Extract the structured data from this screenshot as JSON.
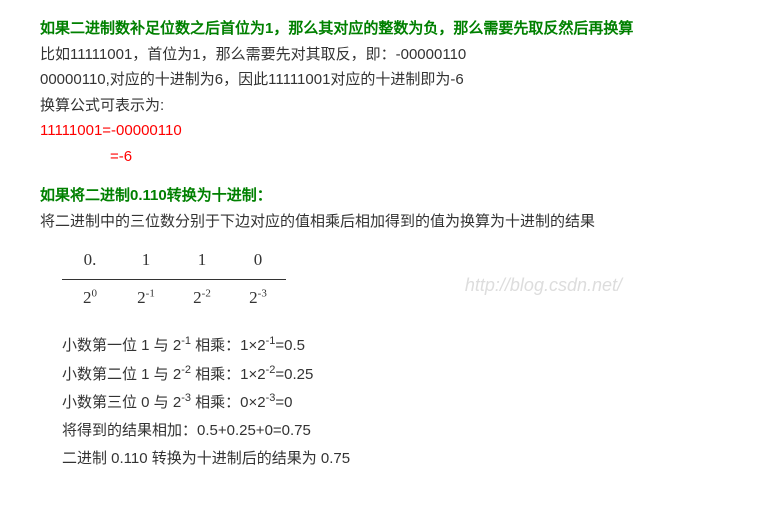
{
  "watermark": "http://blog.csdn.net/",
  "section1": {
    "heading": "如果二进制数补足位数之后首位为1，那么其对应的整数为负，那么需要先取反然后再换算",
    "line1": "比如11111001，首位为1，那么需要先对其取反，即：-00000110",
    "line2": "00000110,对应的十进制为6，因此11111001对应的十进制即为-6",
    "line3": "换算公式可表示为:",
    "code1": "11111001=-00000110",
    "code2": "=-6"
  },
  "section2": {
    "heading": "如果将二进制0.110转换为十进制：",
    "line1": "将二进制中的三位数分别于下边对应的值相乘后相加得到的值为换算为十进制的结果",
    "table": {
      "r1c1": "0.",
      "r1c2": "1",
      "r1c3": "1",
      "r1c4": "0",
      "r2c1_base": "2",
      "r2c1_exp": "0",
      "r2c2_base": "2",
      "r2c2_exp": "-1",
      "r2c3_base": "2",
      "r2c3_exp": "-2",
      "r2c4_base": "2",
      "r2c4_exp": "-3"
    },
    "steps": {
      "s1_a": "小数第一位 1 与 2",
      "s1_exp": "-1",
      "s1_b": " 相乘：1×2",
      "s1_exp2": "-1",
      "s1_c": "=0.5",
      "s2_a": "小数第二位 1 与 2",
      "s2_exp": "-2",
      "s2_b": " 相乘：1×2",
      "s2_exp2": "-2",
      "s2_c": "=0.25",
      "s3_a": "小数第三位 0 与 2",
      "s3_exp": "-3",
      "s3_b": " 相乘：0×2",
      "s3_exp2": "-3",
      "s3_c": "=0",
      "s4": "将得到的结果相加：0.5+0.25+0=0.75",
      "s5": "二进制 0.110 转换为十进制后的结果为 0.75"
    }
  }
}
